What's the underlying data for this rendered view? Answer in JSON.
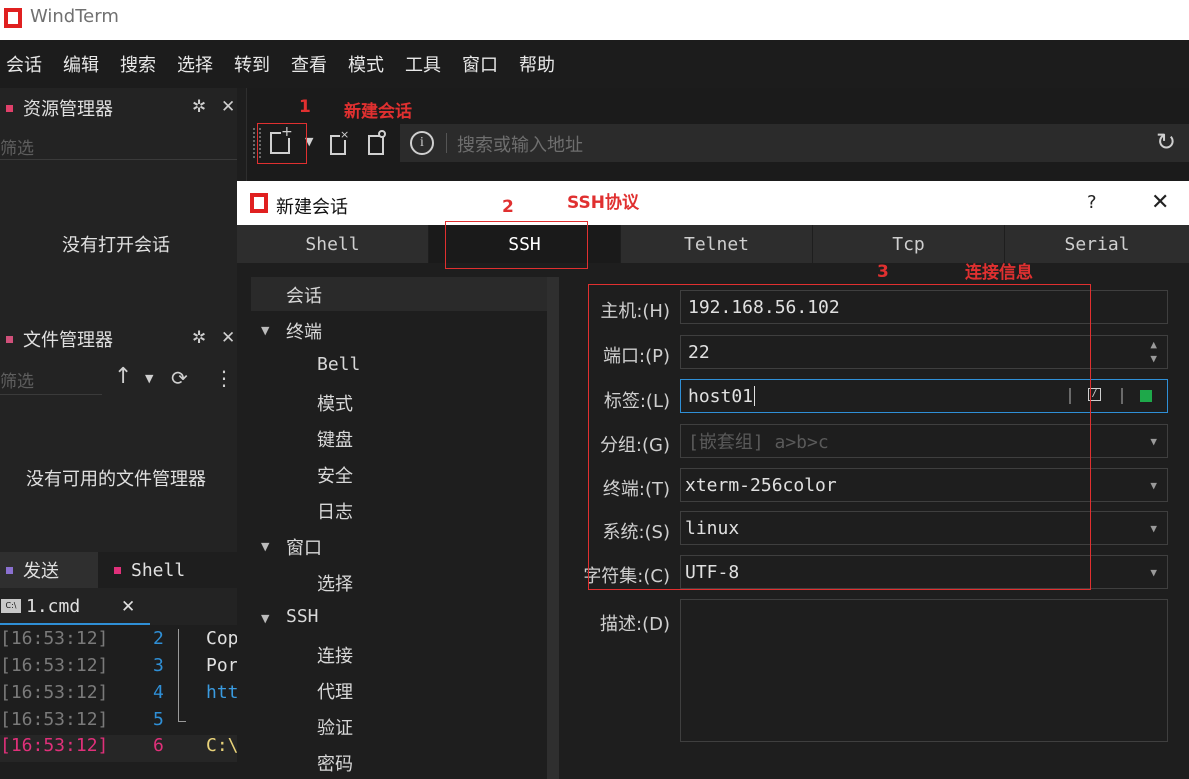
{
  "app": {
    "title": "WindTerm"
  },
  "menu": [
    "会话",
    "编辑",
    "搜索",
    "选择",
    "转到",
    "查看",
    "模式",
    "工具",
    "窗口",
    "帮助"
  ],
  "resource_pane": {
    "title": "资源管理器",
    "filter_placeholder": "筛选",
    "empty_text": "没有打开会话"
  },
  "file_pane": {
    "title": "文件管理器",
    "filter_placeholder": "筛选",
    "empty_text": "没有可用的文件管理器"
  },
  "bottom_tabs": {
    "send": "发送",
    "shell": "Shell"
  },
  "cmd_tab": {
    "label": "1.cmd",
    "close": "✕"
  },
  "log_rows": [
    {
      "time": "[16:53:12]",
      "num": "2",
      "text": "Cop"
    },
    {
      "time": "[16:53:12]",
      "num": "3",
      "text": "Por"
    },
    {
      "time": "[16:53:12]",
      "num": "4",
      "text": "htt"
    },
    {
      "time": "[16:53:12]",
      "num": "5",
      "text": ""
    },
    {
      "time": "[16:53:12]",
      "num": "6",
      "text": "C:\\"
    }
  ],
  "address": {
    "placeholder": "搜索或输入地址"
  },
  "annotations": {
    "a1": "1",
    "a1_text": "新建会话",
    "a2": "2",
    "a2_text": "SSH协议",
    "a3": "3",
    "a3_text": "连接信息"
  },
  "dialog": {
    "title": "新建会话",
    "help": "?",
    "close": "✕",
    "tabs": [
      "Shell",
      "SSH",
      "Telnet",
      "Tcp",
      "Serial"
    ],
    "active_tab": "SSH",
    "tree": [
      {
        "label": "会话",
        "level": 0,
        "expandable": false,
        "selected": true
      },
      {
        "label": "终端",
        "level": 0,
        "expandable": true
      },
      {
        "label": "Bell",
        "level": 1
      },
      {
        "label": "模式",
        "level": 1
      },
      {
        "label": "键盘",
        "level": 1
      },
      {
        "label": "安全",
        "level": 1
      },
      {
        "label": "日志",
        "level": 1
      },
      {
        "label": "窗口",
        "level": 0,
        "expandable": true
      },
      {
        "label": "选择",
        "level": 1
      },
      {
        "label": "SSH",
        "level": 0,
        "expandable": true
      },
      {
        "label": "连接",
        "level": 1
      },
      {
        "label": "代理",
        "level": 1
      },
      {
        "label": "验证",
        "level": 1
      },
      {
        "label": "密码",
        "level": 1
      }
    ],
    "fields": {
      "host": {
        "label": "主机:(H)",
        "value": "192.168.56.102"
      },
      "port": {
        "label": "端口:(P)",
        "value": "22"
      },
      "tag": {
        "label": "标签:(L)",
        "value": "host01"
      },
      "group": {
        "label": "分组:(G)",
        "placeholder": "[嵌套组] a>b>c"
      },
      "terminal": {
        "label": "终端:(T)",
        "value": "xterm-256color"
      },
      "system": {
        "label": "系统:(S)",
        "value": "linux"
      },
      "charset": {
        "label": "字符集:(C)",
        "value": "UTF-8"
      },
      "description": {
        "label": "描述:(D)",
        "value": ""
      }
    }
  }
}
